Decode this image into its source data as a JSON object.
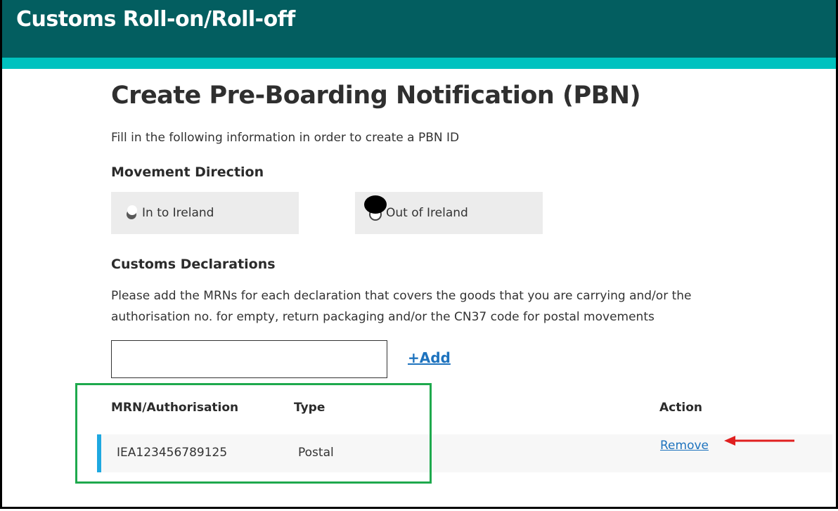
{
  "header": {
    "title": "Customs Roll-on/Roll-off"
  },
  "page": {
    "title": "Create Pre-Boarding Notification (PBN)",
    "intro": "Fill in the following information in order to create a PBN ID"
  },
  "movement_direction": {
    "label": "Movement Direction",
    "options": [
      {
        "label": "In to Ireland"
      },
      {
        "label": "Out of Ireland"
      }
    ]
  },
  "customs_declarations": {
    "label": "Customs Declarations",
    "description": "Please add the MRNs for each declaration that covers the goods that you are carrying and/or the authorisation no. for empty, return packaging and/or the CN37 code for postal movements",
    "input_value": "",
    "add_label": "+Add"
  },
  "table": {
    "headers": {
      "mrn": "MRN/Authorisation",
      "type": "Type",
      "action": "Action"
    },
    "rows": [
      {
        "mrn": "IEA123456789125",
        "type": "Postal",
        "action": "Remove"
      }
    ]
  },
  "colors": {
    "header_bg": "#035e60",
    "accent_bar": "#00c2bf",
    "link": "#1e73be",
    "highlight_box": "#1ea94d",
    "annotation_arrow": "#e02020"
  }
}
